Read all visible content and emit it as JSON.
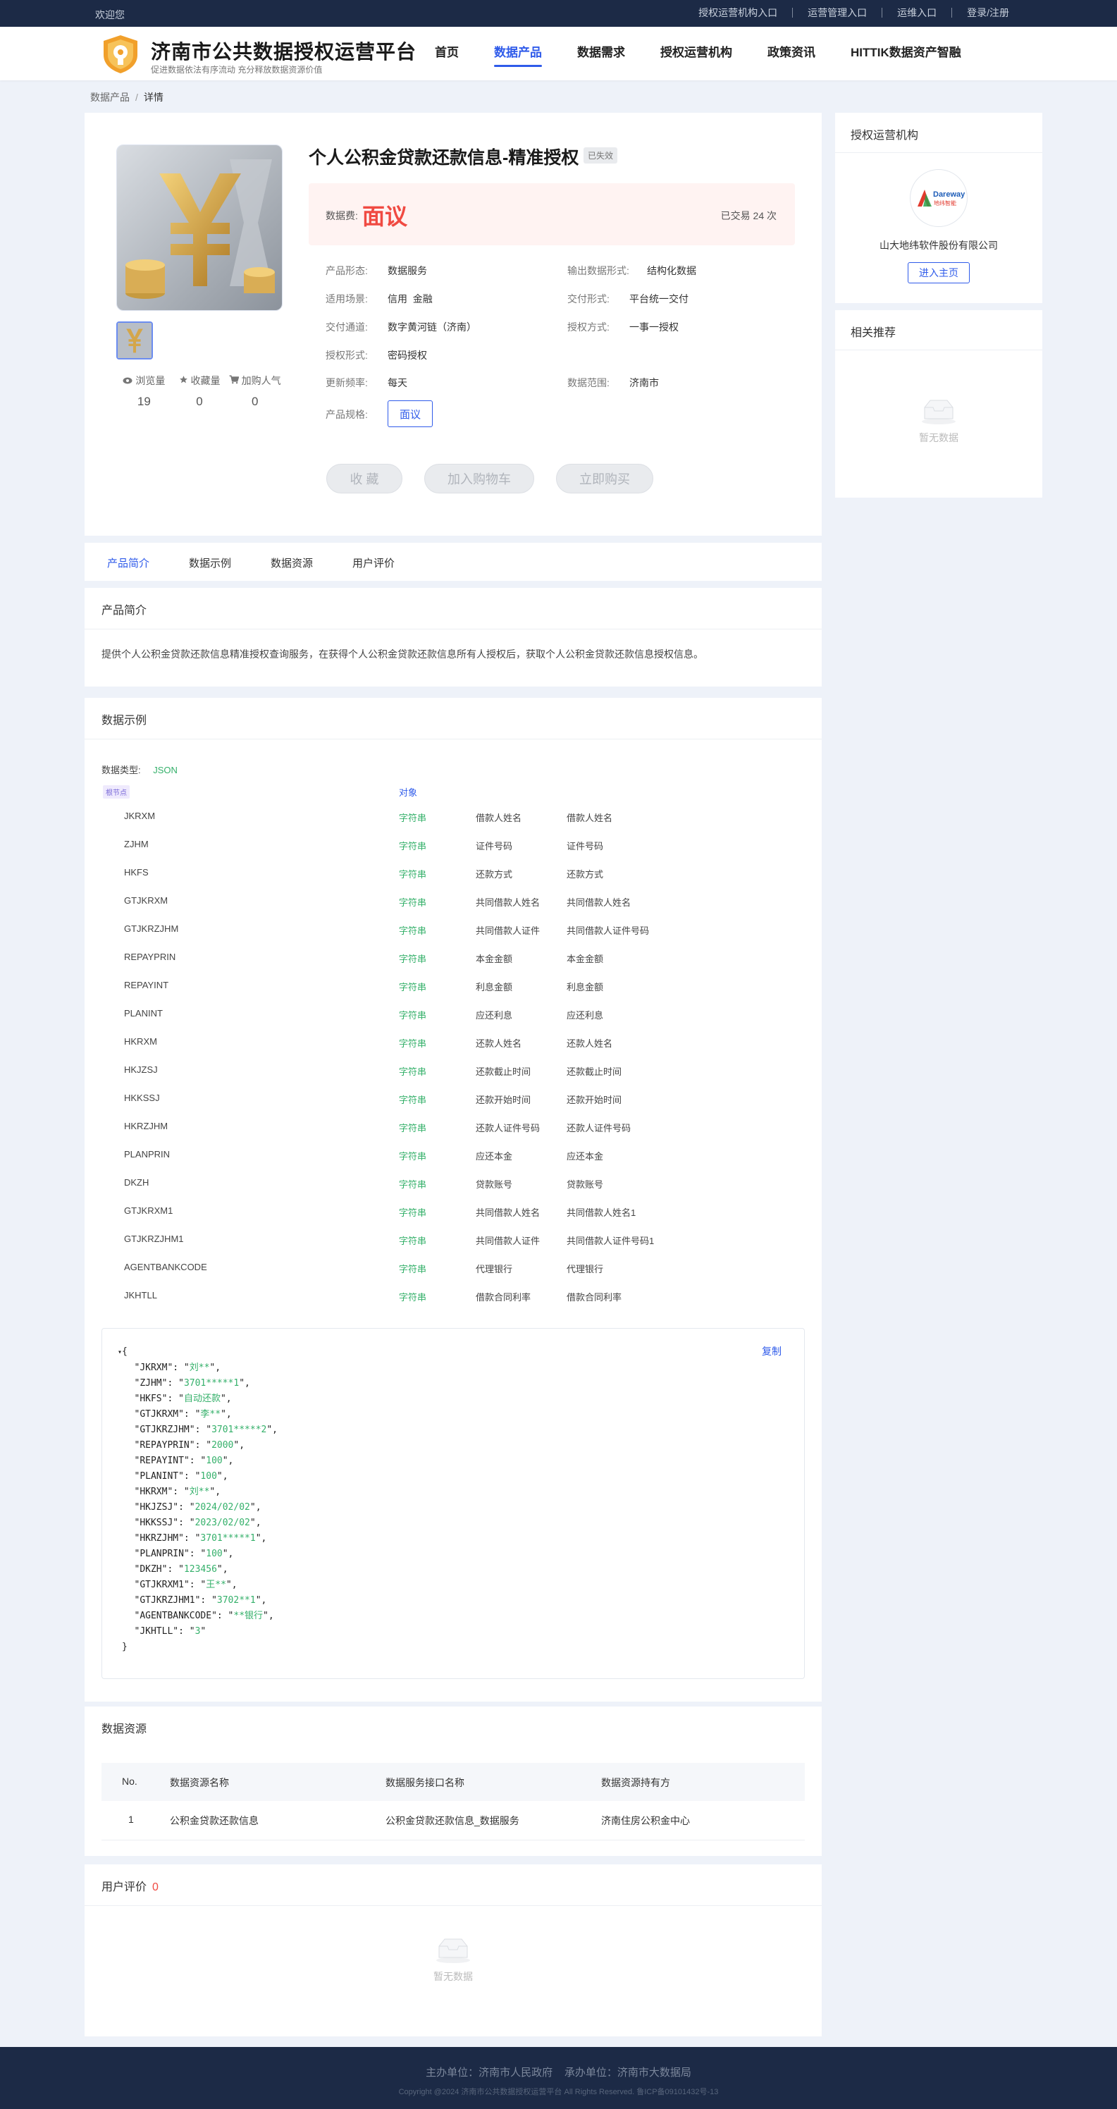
{
  "topbar": {
    "welcome": "欢迎您",
    "links": [
      "授权运营机构入口",
      "运营管理入口",
      "运维入口",
      "登录/注册"
    ]
  },
  "header": {
    "title": "济南市公共数据授权运营平台",
    "subtitle": "促进数据依法有序流动 充分释放数据资源价值",
    "nav": [
      "首页",
      "数据产品",
      "数据需求",
      "授权运营机构",
      "政策资讯",
      "HITTIK数据资产智融"
    ],
    "nav_active": "数据产品"
  },
  "breadcrumb": {
    "parent": "数据产品",
    "sep": "/",
    "current": "详情"
  },
  "product": {
    "title": "个人公积金贷款还款信息-精准授权",
    "status_tag": "已失效",
    "price_label": "数据费:",
    "price_value": "面议",
    "traded": "已交易 24 次",
    "stats": [
      {
        "icon": "eye-icon",
        "label": "浏览量",
        "value": "19"
      },
      {
        "icon": "star-icon",
        "label": "收藏量",
        "value": "0"
      },
      {
        "icon": "cart-icon",
        "label": "加购人气",
        "value": "0"
      }
    ],
    "attrs": {
      "form_k": "产品形态:",
      "form_v": "数据服务",
      "output_k": "输出数据形式:",
      "output_v": "结构化数据",
      "scene_k": "适用场景:",
      "scene_v": "信用  金融",
      "delivery_k": "交付形式:",
      "delivery_v": "平台统一交付",
      "channel_k": "交付通道:",
      "channel_v": "数字黄河链（济南）",
      "auth_k": "授权方式:",
      "auth_v": "一事一授权",
      "authform_k": "授权形式:",
      "authform_v": "密码授权",
      "freq_k": "更新频率:",
      "freq_v": "每天",
      "range_k": "数据范围:",
      "range_v": "济南市",
      "spec_k": "产品规格:",
      "spec_v": "面议"
    },
    "buttons": {
      "fav": "收 藏",
      "cart": "加入购物车",
      "buy": "立即购买"
    }
  },
  "org": {
    "title": "授权运营机构",
    "logo_text_top": "Dareway",
    "logo_text_bottom": "地纬智能",
    "name": "山大地纬软件股份有限公司",
    "button": "进入主页"
  },
  "recommend": {
    "title": "相关推荐",
    "empty": "暂无数据"
  },
  "tabs": [
    "产品简介",
    "数据示例",
    "数据资源",
    "用户评价"
  ],
  "intro": {
    "title": "产品简介",
    "text": "提供个人公积金贷款还款信息精准授权查询服务，在获得个人公积金贷款还款信息所有人授权后，获取个人公积金贷款还款信息授权信息。"
  },
  "example": {
    "title": "数据示例",
    "type_label": "数据类型:",
    "type_value": "JSON",
    "root_tag": "根节点",
    "root_type": "对象",
    "fields": [
      {
        "name": "JKRXM",
        "type": "字符串",
        "d1": "借款人姓名",
        "d2": "借款人姓名"
      },
      {
        "name": "ZJHM",
        "type": "字符串",
        "d1": "证件号码",
        "d2": "证件号码"
      },
      {
        "name": "HKFS",
        "type": "字符串",
        "d1": "还款方式",
        "d2": "还款方式"
      },
      {
        "name": "GTJKRXM",
        "type": "字符串",
        "d1": "共同借款人姓名",
        "d2": "共同借款人姓名"
      },
      {
        "name": "GTJKRZJHM",
        "type": "字符串",
        "d1": "共同借款人证件",
        "d2": "共同借款人证件号码"
      },
      {
        "name": "REPAYPRIN",
        "type": "字符串",
        "d1": "本金金额",
        "d2": "本金金额"
      },
      {
        "name": "REPAYINT",
        "type": "字符串",
        "d1": "利息金额",
        "d2": "利息金额"
      },
      {
        "name": "PLANINT",
        "type": "字符串",
        "d1": "应还利息",
        "d2": "应还利息"
      },
      {
        "name": "HKRXM",
        "type": "字符串",
        "d1": "还款人姓名",
        "d2": "还款人姓名"
      },
      {
        "name": "HKJZSJ",
        "type": "字符串",
        "d1": "还款截止时间",
        "d2": "还款截止时间"
      },
      {
        "name": "HKKSSJ",
        "type": "字符串",
        "d1": "还款开始时间",
        "d2": "还款开始时间"
      },
      {
        "name": "HKRZJHM",
        "type": "字符串",
        "d1": "还款人证件号码",
        "d2": "还款人证件号码"
      },
      {
        "name": "PLANPRIN",
        "type": "字符串",
        "d1": "应还本金",
        "d2": "应还本金"
      },
      {
        "name": "DKZH",
        "type": "字符串",
        "d1": "贷款账号",
        "d2": "贷款账号"
      },
      {
        "name": "GTJKRXM1",
        "type": "字符串",
        "d1": "共同借款人姓名",
        "d2": "共同借款人姓名1"
      },
      {
        "name": "GTJKRZJHM1",
        "type": "字符串",
        "d1": "共同借款人证件",
        "d2": "共同借款人证件号码1"
      },
      {
        "name": "AGENTBANKCODE",
        "type": "字符串",
        "d1": "代理银行",
        "d2": "代理银行"
      },
      {
        "name": "JKHTLL",
        "type": "字符串",
        "d1": "借款合同利率",
        "d2": "借款合同利率"
      }
    ],
    "copy": "复制",
    "json_open": "{",
    "json_close": "}",
    "json": [
      {
        "k": "JKRXM",
        "v": "刘**"
      },
      {
        "k": "ZJHM",
        "v": "3701*****1"
      },
      {
        "k": "HKFS",
        "v": "自动还款"
      },
      {
        "k": "GTJKRXM",
        "v": "李**"
      },
      {
        "k": "GTJKRZJHM",
        "v": "3701*****2"
      },
      {
        "k": "REPAYPRIN",
        "v": "2000"
      },
      {
        "k": "REPAYINT",
        "v": "100"
      },
      {
        "k": "PLANINT",
        "v": "100"
      },
      {
        "k": "HKRXM",
        "v": "刘**"
      },
      {
        "k": "HKJZSJ",
        "v": "2024/02/02"
      },
      {
        "k": "HKKSSJ",
        "v": "2023/02/02"
      },
      {
        "k": "HKRZJHM",
        "v": "3701*****1"
      },
      {
        "k": "PLANPRIN",
        "v": "100"
      },
      {
        "k": "DKZH",
        "v": "123456"
      },
      {
        "k": "GTJKRXM1",
        "v": "王**"
      },
      {
        "k": "GTJKRZJHM1",
        "v": "3702**1"
      },
      {
        "k": "AGENTBANKCODE",
        "v": "**银行"
      },
      {
        "k": "JKHTLL",
        "v": "3"
      }
    ]
  },
  "resource": {
    "title": "数据资源",
    "headers": [
      "No.",
      "数据资源名称",
      "数据服务接口名称",
      "数据资源持有方"
    ],
    "rows": [
      [
        "1",
        "公积金贷款还款信息",
        "公积金贷款还款信息_数据服务",
        "济南住房公积金中心"
      ]
    ]
  },
  "review": {
    "title": "用户评价",
    "count": "0",
    "empty": "暂无数据"
  },
  "footer": {
    "line1": "主办单位：济南市人民政府    承办单位：济南市大数据局",
    "line2": "Copyright @2024 济南市公共数据授权运营平台 All Rights Reserved. 鲁ICP备09101432号-13"
  },
  "colors": {
    "accent": "#2f5bea",
    "price": "#f04a42",
    "string_type": "#34b06a",
    "dark_bg": "#1c2a46"
  }
}
